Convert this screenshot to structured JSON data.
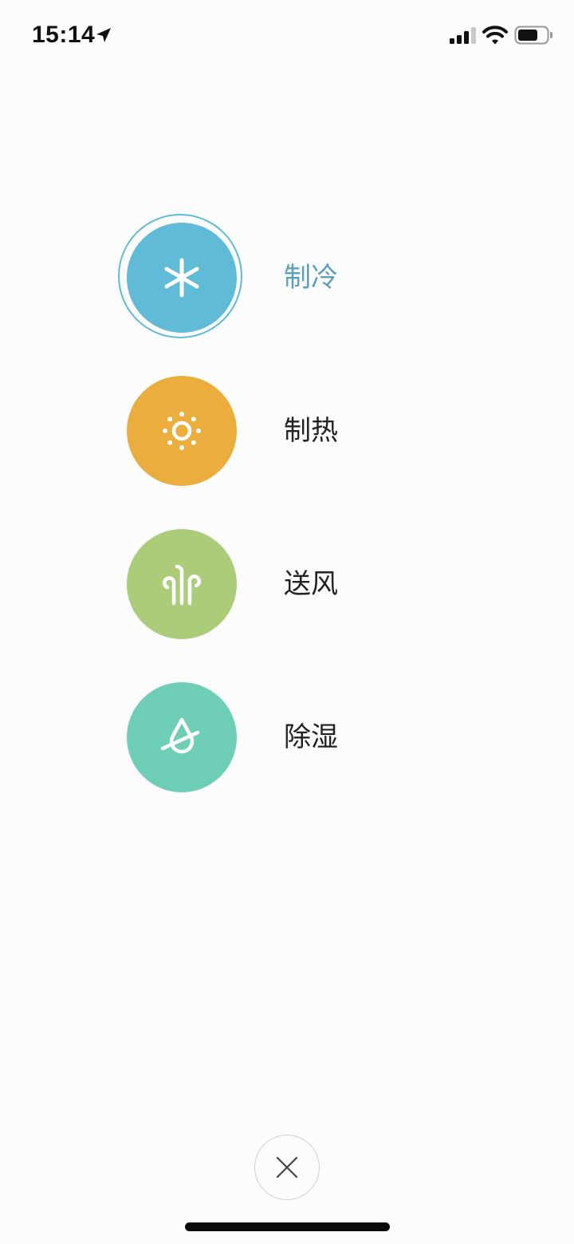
{
  "status_bar": {
    "time": "15:14",
    "location_icon": "location-arrow-icon",
    "signal_icon": "cellular-signal-icon",
    "wifi_icon": "wifi-icon",
    "battery_icon": "battery-icon"
  },
  "modes": [
    {
      "label": "制冷",
      "icon": "snowflake-icon",
      "color": "#5fbbd6",
      "label_color": "#5aa0bb",
      "selected": true
    },
    {
      "label": "制热",
      "icon": "sun-icon",
      "color": "#ebad3e",
      "label_color": "#222222",
      "selected": false
    },
    {
      "label": "送风",
      "icon": "fan-wind-icon",
      "color": "#abcc78",
      "label_color": "#222222",
      "selected": false
    },
    {
      "label": "除湿",
      "icon": "dehumidify-drop-icon",
      "color": "#6ecfb6",
      "label_color": "#222222",
      "selected": false
    }
  ],
  "close_button": {
    "icon": "close-icon"
  }
}
